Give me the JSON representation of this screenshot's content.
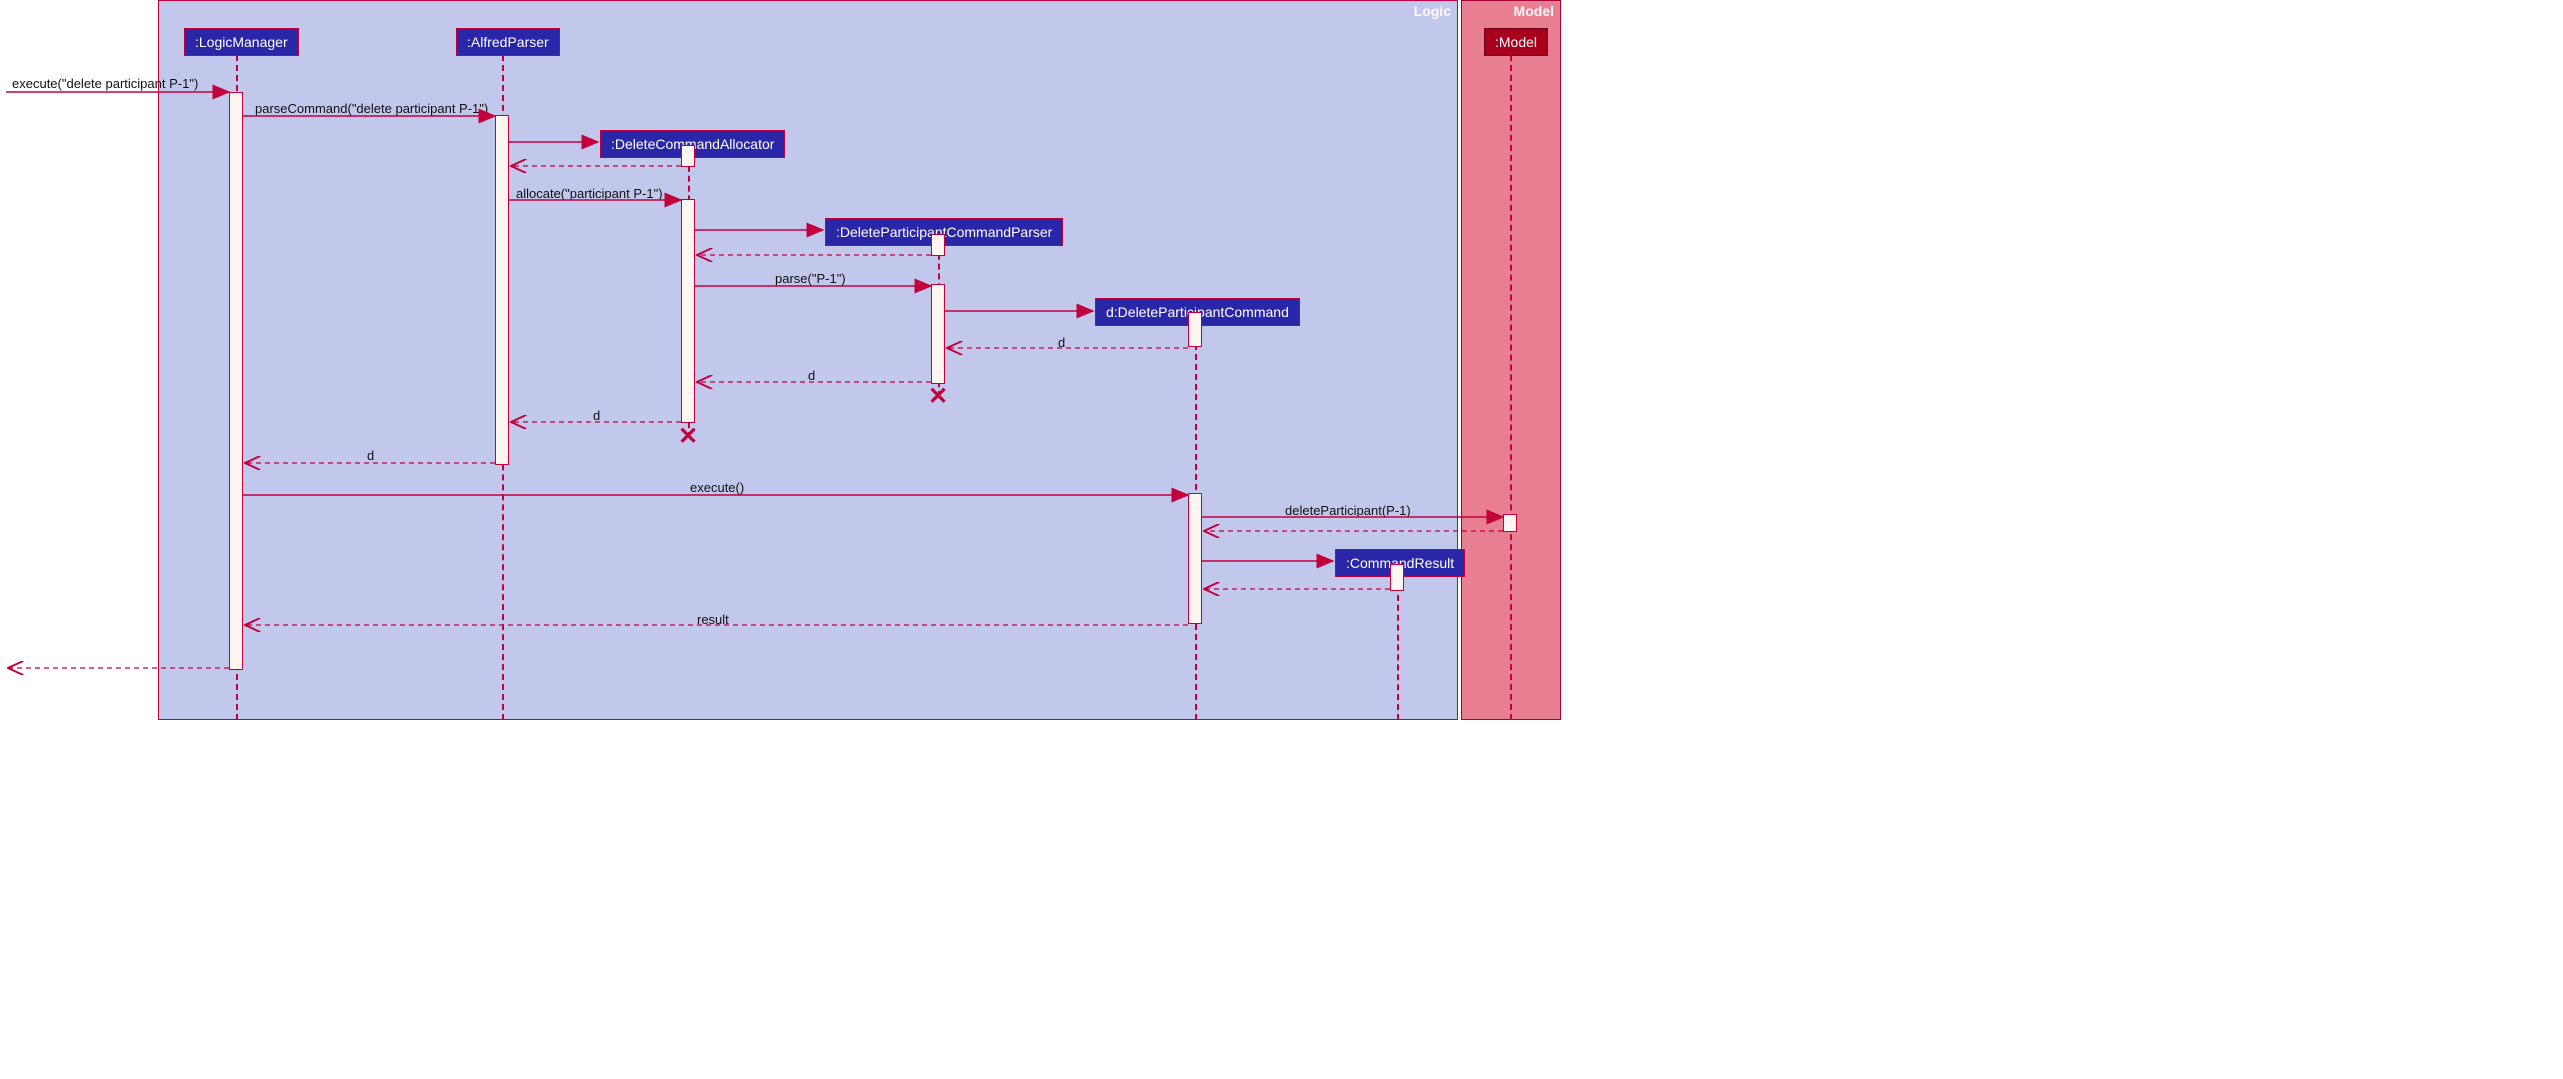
{
  "frames": {
    "logic": {
      "label": "Logic"
    },
    "model": {
      "label": "Model"
    }
  },
  "lifelines": {
    "logicManager": {
      "label": ":LogicManager"
    },
    "alfredParser": {
      "label": ":AlfredParser"
    },
    "deleteCommandAllocator": {
      "label": ":DeleteCommandAllocator"
    },
    "deleteParticipantCommandParser": {
      "label": ":DeleteParticipantCommandParser"
    },
    "deleteParticipantCommand": {
      "label": "d:DeleteParticipantCommand"
    },
    "commandResult": {
      "label": ":CommandResult"
    },
    "model": {
      "label": ":Model"
    }
  },
  "messages": {
    "execute1": "execute(\"delete participant P-1\")",
    "parseCommand": "parseCommand(\"delete participant P-1\")",
    "allocate": "allocate(\"participant P-1\")",
    "parse": "parse(\"P-1\")",
    "return_d1": "d",
    "return_d2": "d",
    "return_d3": "d",
    "return_d4": "d",
    "executeCall": "execute()",
    "deleteParticipant": "deleteParticipant(P-1)",
    "result": "result"
  }
}
